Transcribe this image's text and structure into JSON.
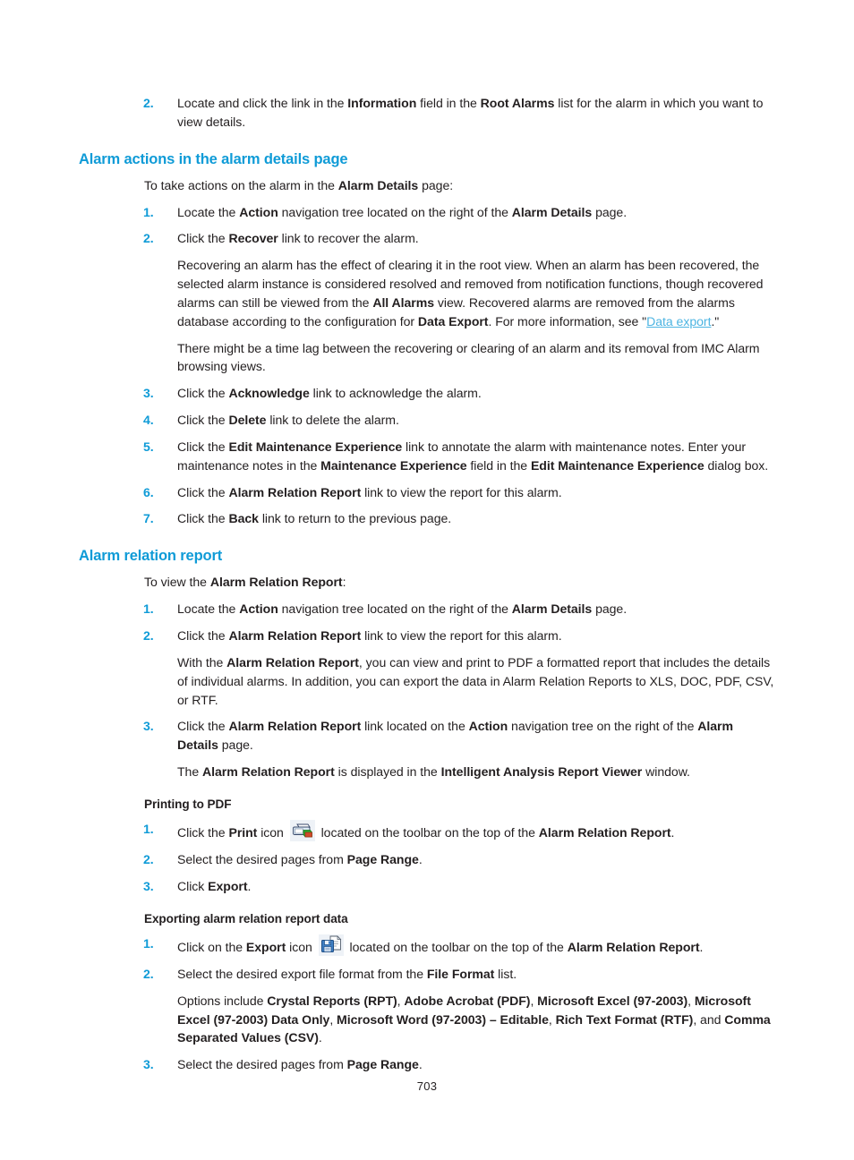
{
  "document": {
    "page_number": "703",
    "accent_color": "#0f9bd7",
    "link_color": "#4cb4e2",
    "text_color": "#231f20"
  },
  "top_step": {
    "num": "2.",
    "text_1": "Locate and click the link in the ",
    "bold_1": "Information",
    "text_2": " field in the ",
    "bold_2": "Root Alarms",
    "text_3": " list for the alarm in which you want to view details."
  },
  "section_alarm_actions": {
    "heading": "Alarm actions in the alarm details page",
    "intro": {
      "text_1": "To take actions on the alarm in the ",
      "bold_1": "Alarm Details",
      "text_2": " page:"
    },
    "steps": [
      {
        "num": "1.",
        "text_1": "Locate the ",
        "bold_1": "Action",
        "text_2": " navigation tree located on the right of the ",
        "bold_2": "Alarm Details",
        "text_3": " page."
      },
      {
        "num": "2.",
        "text_1": "Click the ",
        "bold_1": "Recover",
        "text_2": " link to recover the alarm."
      },
      {
        "num": "3.",
        "text_1": "Click the ",
        "bold_1": "Acknowledge",
        "text_2": " link to acknowledge the alarm."
      },
      {
        "num": "4.",
        "text_1": "Click the ",
        "bold_1": "Delete",
        "text_2": " link to delete the alarm."
      },
      {
        "num": "5.",
        "text_1": "Click the ",
        "bold_1": "Edit Maintenance Experience",
        "text_2": " link to annotate the alarm with maintenance notes. Enter your maintenance notes in the ",
        "bold_2": "Maintenance Experience",
        "text_3": " field in the ",
        "bold_3": "Edit Maintenance Experience",
        "text_4": " dialog box."
      },
      {
        "num": "6.",
        "text_1": "Click the ",
        "bold_1": "Alarm Relation Report",
        "text_2": " link to view the report for this alarm."
      },
      {
        "num": "7.",
        "text_1": "Click the ",
        "bold_1": "Back",
        "text_2": " link to return to the previous page."
      }
    ],
    "recover_para_1": {
      "text_1": "Recovering an alarm has the effect of clearing it in the root view. When an alarm has been recovered, the selected alarm instance is considered resolved and removed from notification functions, though recovered alarms can still be viewed from the ",
      "bold_1": "All Alarms",
      "text_2": " view. Recovered alarms are removed from the alarms database according to the configuration for ",
      "bold_2": "Data Export",
      "text_3": ". For more information, see \"",
      "link_1": "Data export",
      "text_4": ".\""
    },
    "recover_para_2": {
      "text_1": "There might be a time lag between the recovering or clearing of an alarm and its removal from IMC Alarm browsing views."
    }
  },
  "section_alarm_relation_report": {
    "heading": "Alarm relation report",
    "intro": {
      "text_1": "To view the ",
      "bold_1": "Alarm Relation Report",
      "text_2": ":"
    },
    "steps": [
      {
        "num": "1.",
        "text_1": "Locate the ",
        "bold_1": "Action",
        "text_2": " navigation tree located on the right of the ",
        "bold_2": "Alarm Details",
        "text_3": " page."
      },
      {
        "num": "2.",
        "text_1": "Click the ",
        "bold_1": "Alarm Relation Report",
        "text_2": " link to view the report for this alarm."
      },
      {
        "num": "3.",
        "text_1": "Click the ",
        "bold_1": "Alarm Relation Report",
        "text_2": " link located on the ",
        "bold_2": "Action",
        "text_3": " navigation tree on the right of the ",
        "bold_3": "Alarm Details",
        "text_4": " page."
      }
    ],
    "report_para": {
      "text_1": "With the ",
      "bold_1": "Alarm Relation Report",
      "text_2": ", you can view and print to PDF a formatted report that includes the details of individual alarms. In addition, you can export the data in Alarm Relation Reports to XLS, DOC, PDF, CSV, or RTF."
    },
    "viewer_para": {
      "text_1": "The ",
      "bold_1": "Alarm Relation Report",
      "text_2": " is displayed in the ",
      "bold_2": "Intelligent Analysis Report Viewer",
      "text_3": " window."
    }
  },
  "subsection_printing_to_pdf": {
    "heading": "Printing to PDF",
    "steps": [
      {
        "num": "1.",
        "text_1": "Click the ",
        "bold_1": "Print",
        "text_2": " icon ",
        "icon": "print-icon",
        "text_3": " located on the toolbar on the top of the ",
        "bold_2": "Alarm Relation Report",
        "text_4": "."
      },
      {
        "num": "2.",
        "text_1": "Select the desired pages from ",
        "bold_1": "Page Range",
        "text_2": "."
      },
      {
        "num": "3.",
        "text_1": "Click ",
        "bold_1": "Export",
        "text_2": "."
      }
    ]
  },
  "subsection_exporting_data": {
    "heading": "Exporting alarm relation report data",
    "steps": [
      {
        "num": "1.",
        "text_1": "Click on the ",
        "bold_1": "Export",
        "text_2": " icon ",
        "icon": "export-icon",
        "text_3": " located on the toolbar on the top of the ",
        "bold_2": "Alarm Relation Report",
        "text_4": "."
      },
      {
        "num": "2.",
        "text_1": "Select the desired export file format from the ",
        "bold_1": "File Format",
        "text_2": " list."
      },
      {
        "num": "3.",
        "text_1": "Select the desired pages from ",
        "bold_1": "Page Range",
        "text_2": "."
      }
    ],
    "options_para": {
      "text_1": "Options include ",
      "bold_1": "Crystal Reports (RPT)",
      "text_2": ", ",
      "bold_2": "Adobe Acrobat (PDF)",
      "text_3": ", ",
      "bold_3": "Microsoft Excel (97-2003)",
      "text_4": ", ",
      "bold_4": "Microsoft Excel (97-2003) Data Only",
      "text_5": ", ",
      "bold_5": "Microsoft Word (97-2003) – Editable",
      "text_6": ", ",
      "bold_6": "Rich Text Format (RTF)",
      "text_7": ", and ",
      "bold_7": "Comma Separated Values (CSV)",
      "text_8": "."
    }
  }
}
